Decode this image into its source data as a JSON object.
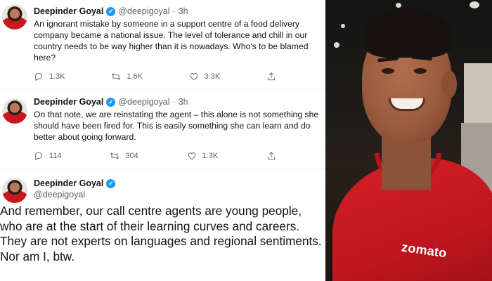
{
  "tweets": [
    {
      "name": "Deepinder Goyal",
      "handle": "@deepigoyal",
      "separator": "·",
      "time": "3h",
      "text": "An ignorant mistake by someone in a support centre of a food delivery company became a national issue. The level of tolerance and chill in our country needs to be way higher than it is nowadays. Who's to be blamed here?",
      "replies": "1.3K",
      "retweets": "1.6K",
      "likes": "3.3K"
    },
    {
      "name": "Deepinder Goyal",
      "handle": "@deepigoyal",
      "separator": "·",
      "time": "3h",
      "text": "On that note, we are reinstating the agent – this alone is not something she should have been fired for. This is easily something she can learn and do better about going forward.",
      "replies": "114",
      "retweets": "304",
      "likes": "1.3K"
    },
    {
      "name": "Deepinder Goyal",
      "handle": "@deepigoyal",
      "text": "And remember, our call centre agents are young people, who are at the start of their learning curves and careers. They are not experts on languages and regional sentiments. Nor am I, btw."
    }
  ],
  "photo": {
    "shirt_logo": "zomato",
    "shirt_color": "#c8191f"
  },
  "colors": {
    "verified": "#1d9bf0",
    "muted_text": "#536471"
  },
  "icons": {
    "reply": "reply-icon",
    "retweet": "retweet-icon",
    "like": "heart-icon",
    "share": "share-icon",
    "verified": "verified-badge-icon"
  }
}
